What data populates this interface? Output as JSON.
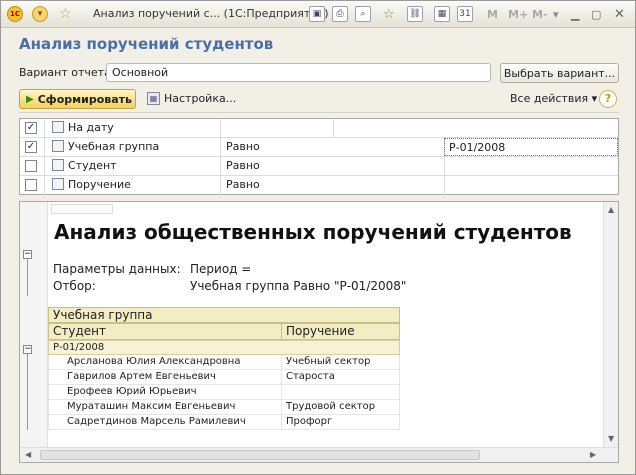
{
  "window": {
    "logo": "1C",
    "title": "Анализ поручений с...  (1С:Предприятие)",
    "right_buttons": [
      "M",
      "M+",
      "M-"
    ]
  },
  "form": {
    "title": "Анализ поручений студентов",
    "variant_label": "Вариант отчета:",
    "variant_value": "Основной",
    "choose_variant": "Выбрать вариант...",
    "generate": "Сформировать",
    "settings": "Настройка...",
    "all_actions": "Все действия",
    "help": "?"
  },
  "params": [
    {
      "checked": true,
      "name": "На дату",
      "condition": "",
      "value": ""
    },
    {
      "checked": true,
      "name": "Учебная группа",
      "condition": "Равно",
      "value": "Р-01/2008"
    },
    {
      "checked": false,
      "name": "Студент",
      "condition": "Равно",
      "value": ""
    },
    {
      "checked": false,
      "name": "Поручение",
      "condition": "Равно",
      "value": ""
    }
  ],
  "report": {
    "title": "Анализ общественных поручений студентов",
    "params_label": "Параметры данных:",
    "params_value": "Период =",
    "filter_label": "Отбор:",
    "filter_value": "Учебная группа Равно \"Р-01/2008\"",
    "group_header": "Учебная группа",
    "col_student": "Студент",
    "col_assignment": "Поручение",
    "group_value": "Р-01/2008",
    "rows": [
      {
        "student": "Арсланова Юлия Александровна",
        "assignment": "Учебный сектор"
      },
      {
        "student": "Гаврилов Артем Евгеньевич",
        "assignment": "Староста"
      },
      {
        "student": "Ерофеев Юрий Юрьевич",
        "assignment": ""
      },
      {
        "student": "Мураташин Максим Евгеньевич",
        "assignment": "Трудовой сектор"
      },
      {
        "student": "Садретдинов Марсель Рамилевич",
        "assignment": "Профорг"
      }
    ]
  }
}
